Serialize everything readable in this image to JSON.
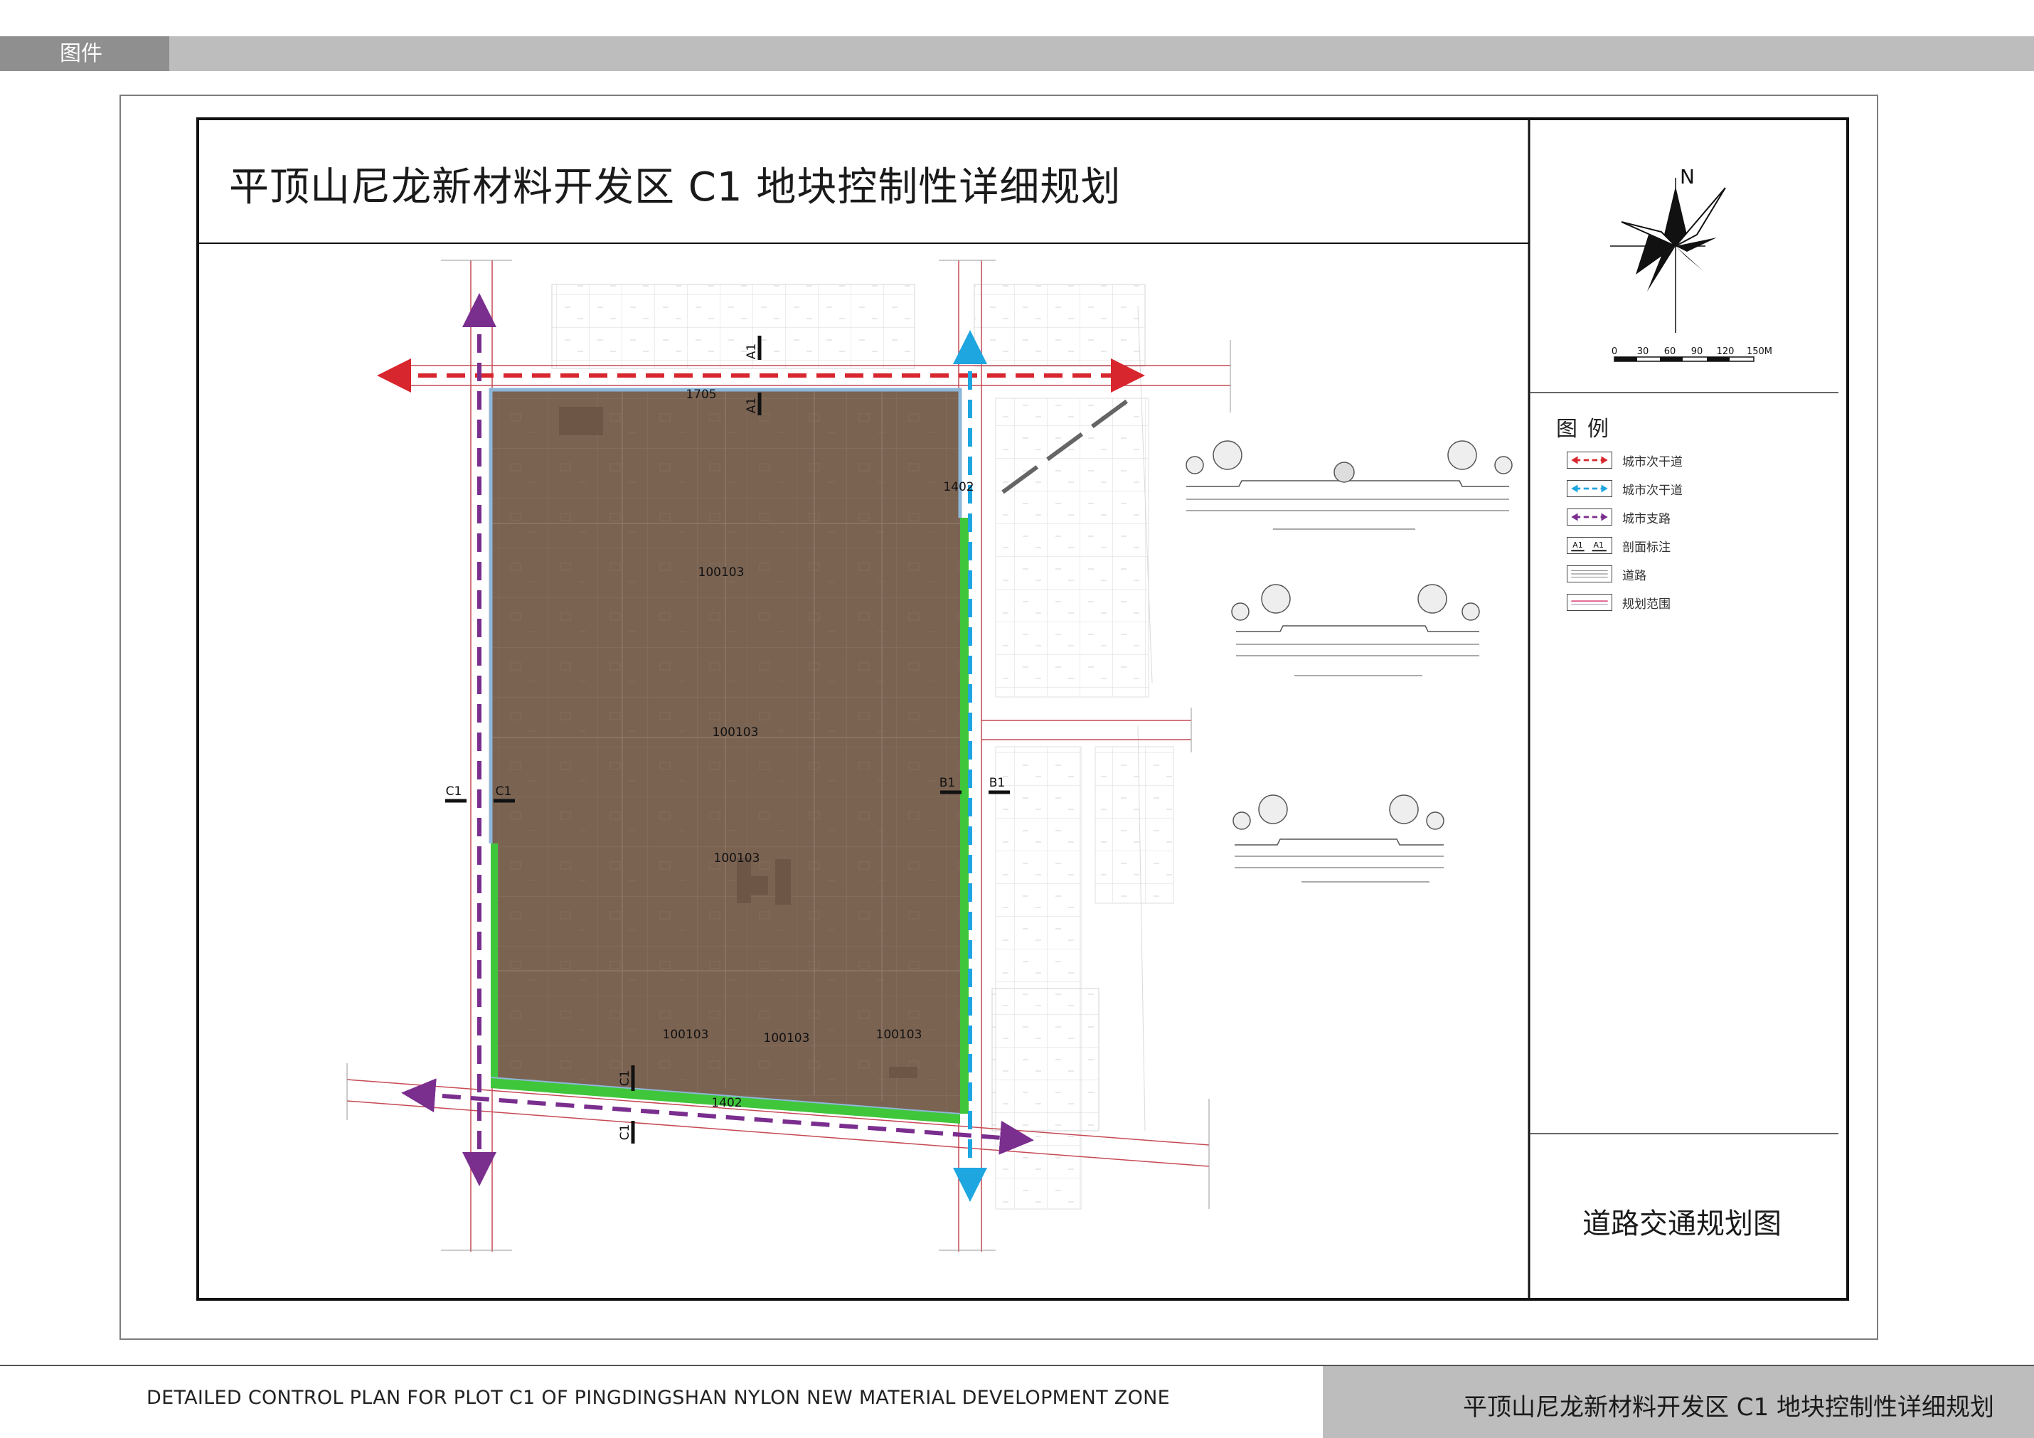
{
  "header": {
    "tab_label": "图件"
  },
  "map": {
    "title": "平顶山尼龙新材料开发区 C1 地块控制性详细规划",
    "panel_title": "道路交通规划图",
    "north_label": "N",
    "scale_bar": {
      "ticks": [
        "0",
        "30",
        "60",
        "90",
        "120",
        "150M"
      ]
    },
    "legend": {
      "title": "图例",
      "items": [
        {
          "label": "城市次干道",
          "color": "#d8262e",
          "type": "arrow"
        },
        {
          "label": "城市次干道",
          "color": "#1ea6e0",
          "type": "arrow"
        },
        {
          "label": "城市支路",
          "color": "#7a2e8e",
          "type": "arrow"
        },
        {
          "label": "剖面标注",
          "type": "section"
        },
        {
          "label": "道路",
          "type": "road"
        },
        {
          "label": "规划范围",
          "type": "boundary"
        }
      ]
    },
    "plot_codes": [
      "100103",
      "100103",
      "100103",
      "100103",
      "100103",
      "100103"
    ],
    "road_numbers": [
      "1705",
      "1402",
      "1402"
    ],
    "section_marks": [
      "A1",
      "A1",
      "B1",
      "B1",
      "C1",
      "C1",
      "C1",
      "C1"
    ],
    "colors": {
      "plot_fill": "#7b6352",
      "green_belt": "#3fc63a",
      "secondary_road_red": "#d8262e",
      "secondary_road_blue": "#1ea6e0",
      "branch_road_purple": "#7a2e8e",
      "boundary_pink": "#e05a8c"
    }
  },
  "footer": {
    "left_text": "DETAILED CONTROL PLAN FOR PLOT C1 OF PINGDINGSHAN NYLON NEW MATERIAL DEVELOPMENT ZONE",
    "right_text": "平顶山尼龙新材料开发区 C1 地块控制性详细规划"
  }
}
